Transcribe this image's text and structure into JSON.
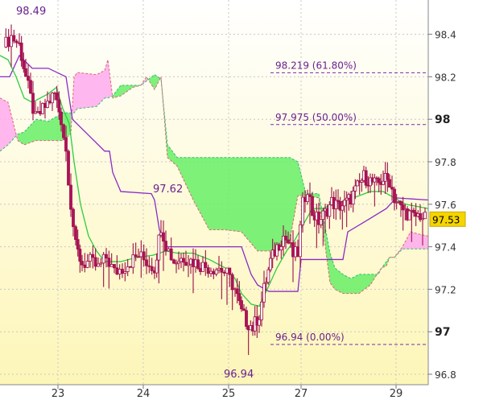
{
  "chart_data": {
    "type": "candlestick",
    "title": "",
    "xlabel": "",
    "ylabel": "",
    "ylim": [
      96.78,
      98.58
    ],
    "x_ticks": [
      "23",
      "24",
      "25",
      "27",
      "29"
    ],
    "y_ticks": [
      {
        "value": 98.4,
        "label": "98.4",
        "major": false
      },
      {
        "value": 98.2,
        "label": "98.2",
        "major": false
      },
      {
        "value": 98.0,
        "label": "98",
        "major": true
      },
      {
        "value": 97.8,
        "label": "97.8",
        "major": false
      },
      {
        "value": 97.6,
        "label": "97.6",
        "major": false
      },
      {
        "value": 97.4,
        "label": "97.4",
        "major": false
      },
      {
        "value": 97.2,
        "label": "97.2",
        "major": false
      },
      {
        "value": 97.0,
        "label": "97",
        "major": true
      },
      {
        "value": 96.8,
        "label": "96.8",
        "major": false
      }
    ],
    "current_price": {
      "value": 97.53,
      "label": "97.53"
    },
    "annotations": [
      {
        "label": "98.49",
        "value": 98.49
      },
      {
        "label": "97.62",
        "value": 97.62
      },
      {
        "label": "96.94",
        "value": 96.94
      }
    ],
    "fibonacci_levels": [
      {
        "value": 98.219,
        "label": "98.219 (61.80%)"
      },
      {
        "value": 97.975,
        "label": "97.975 (50.00%)"
      },
      {
        "value": 96.94,
        "label": "96.94 (0.00%)"
      }
    ],
    "series": [
      {
        "name": "",
        "role": "price",
        "color": "#a01050"
      },
      {
        "name": "",
        "role": "tenkan",
        "color": "#2ecc40"
      },
      {
        "name": "",
        "role": "kijun",
        "color": "#8a2bc8"
      }
    ],
    "cloud_colors": {
      "bullish": "#66ee66",
      "bearish": "#ffaaee"
    },
    "grid": true,
    "background": "#fefce0"
  }
}
